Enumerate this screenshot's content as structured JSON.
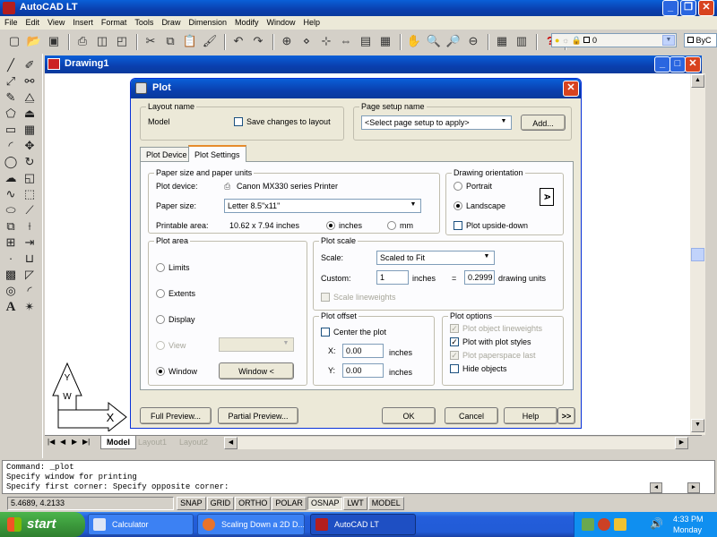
{
  "app": {
    "title": "AutoCAD LT",
    "menu": [
      "File",
      "Edit",
      "View",
      "Insert",
      "Format",
      "Tools",
      "Draw",
      "Dimension",
      "Modify",
      "Window",
      "Help"
    ],
    "layer_box": {
      "value": "0"
    },
    "color_box": {
      "value": "ByC"
    }
  },
  "drawing": {
    "title": "Drawing1",
    "tabs": [
      "Model",
      "Layout1",
      "Layout2"
    ],
    "ucs": {
      "y": "Y",
      "w": "W",
      "x": "X"
    }
  },
  "dialog": {
    "title": "Plot",
    "layout_name": {
      "group_label": "Layout name",
      "value": "Model",
      "save_changes_label": "Save changes to layout",
      "save_changes_checked": false
    },
    "page_setup": {
      "group_label": "Page setup name",
      "select_value": "<Select page setup to apply>",
      "add_button": "Add..."
    },
    "tabs": [
      "Plot Device",
      "Plot Settings"
    ],
    "active_tab": "Plot Settings",
    "paper": {
      "group_label": "Paper size and paper units",
      "plot_device_label": "Plot device:",
      "plot_device_value": "Canon MX330 series Printer",
      "paper_size_label": "Paper size:",
      "paper_size_value": "Letter 8.5\"x11\"",
      "printable_area_label": "Printable area:",
      "printable_area_value": "10.62 x 7.94 inches",
      "inches_label": "inches",
      "mm_label": "mm",
      "units_selected": "inches"
    },
    "orientation": {
      "group_label": "Drawing orientation",
      "portrait_label": "Portrait",
      "landscape_label": "Landscape",
      "selected": "Landscape",
      "upside_down_label": "Plot upside-down",
      "upside_down_checked": false,
      "icon_letter": "A"
    },
    "plot_area": {
      "group_label": "Plot area",
      "options": [
        "Limits",
        "Extents",
        "Display",
        "View",
        "Window"
      ],
      "selected": "Window",
      "window_button": "Window <"
    },
    "plot_scale": {
      "group_label": "Plot scale",
      "scale_label": "Scale:",
      "scale_value": "Scaled to Fit",
      "custom_label": "Custom:",
      "custom_value": "1",
      "inches_label": "inches",
      "equals": "=",
      "drawing_units_value": "0.2999",
      "drawing_units_label": "drawing units",
      "scale_lineweights_label": "Scale lineweights",
      "scale_lineweights_checked": false
    },
    "plot_offset": {
      "group_label": "Plot offset",
      "center_label": "Center the plot",
      "center_checked": false,
      "x_label": "X:",
      "x_value": "0.00",
      "x_unit": "inches",
      "y_label": "Y:",
      "y_value": "0.00",
      "y_unit": "inches"
    },
    "plot_options": {
      "group_label": "Plot options",
      "items": [
        {
          "label": "Plot object lineweights",
          "checked": true,
          "disabled": true
        },
        {
          "label": "Plot with plot styles",
          "checked": true,
          "disabled": false
        },
        {
          "label": "Plot paperspace last",
          "checked": true,
          "disabled": true
        },
        {
          "label": "Hide objects",
          "checked": false,
          "disabled": false
        }
      ]
    },
    "buttons": {
      "full_preview": "Full Preview...",
      "partial_preview": "Partial Preview...",
      "ok": "OK",
      "cancel": "Cancel",
      "help": "Help",
      "more": ">>"
    }
  },
  "command": {
    "lines": [
      "Command: _plot",
      "Specify window for printing",
      "Specify first corner: Specify opposite corner:"
    ]
  },
  "status": {
    "coords": "5.4689, 4.2133",
    "toggles": [
      "SNAP",
      "GRID",
      "ORTHO",
      "POLAR",
      "OSNAP",
      "LWT",
      "MODEL"
    ]
  },
  "taskbar": {
    "start": "start",
    "items": [
      {
        "label": "Calculator",
        "active": false
      },
      {
        "label": "Scaling Down a 2D D...",
        "active": false
      },
      {
        "label": "AutoCAD LT",
        "active": true
      }
    ],
    "time": "4:33 PM",
    "day": "Monday"
  },
  "colors": {
    "xp_blue": "#0a5fd8",
    "taskbar": "#245edb",
    "start_green": "#3c9a3c",
    "dialog_bg": "#ece9d8"
  }
}
